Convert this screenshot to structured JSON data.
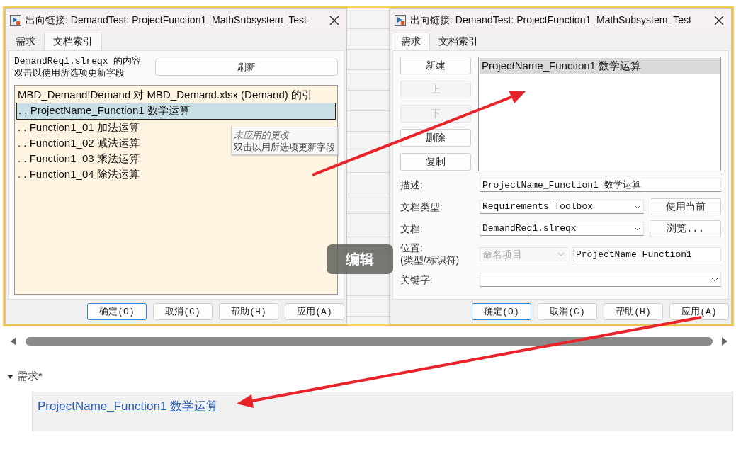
{
  "left_dialog": {
    "title": "出向链接: DemandTest: ProjectFunction1_MathSubsystem_Test",
    "tabs": [
      {
        "label": "需求",
        "selected": false
      },
      {
        "label": "文档索引",
        "selected": true
      }
    ],
    "info_lines": [
      "DemandReq1.slreqx 的内容",
      "双击以使用所选项更新字段"
    ],
    "refresh_button": "刷新",
    "list_header": "MBD_Demand!Demand 对 MBD_Demand.xlsx (Demand) 的引",
    "items": [
      {
        "text": ". . ProjectName_Function1 数学运算",
        "selected": true
      },
      {
        "text": ". . Function1_01 加法运算",
        "selected": false
      },
      {
        "text": ". . Function1_02 减法运算",
        "selected": false
      },
      {
        "text": ". . Function1_03 乘法运算",
        "selected": false
      },
      {
        "text": ". . Function1_04 除法运算",
        "selected": false
      }
    ],
    "tooltip": {
      "title": "未应用的更改",
      "text": "双击以用所选项更新字段"
    },
    "buttons": [
      {
        "label": "确定(O)",
        "default": true
      },
      {
        "label": "取消(C)",
        "default": false
      },
      {
        "label": "帮助(H)",
        "default": false
      },
      {
        "label": "应用(A)",
        "default": false
      }
    ]
  },
  "right_dialog": {
    "title": "出向链接: DemandTest: ProjectFunction1_MathSubsystem_Test",
    "tabs": [
      {
        "label": "需求",
        "selected": true
      },
      {
        "label": "文档索引",
        "selected": false
      }
    ],
    "side_buttons": [
      {
        "label": "新建",
        "disabled": false
      },
      {
        "label": "上",
        "disabled": true
      },
      {
        "label": "下",
        "disabled": true
      },
      {
        "label": "删除",
        "disabled": false
      },
      {
        "label": "复制",
        "disabled": false
      }
    ],
    "requirements": [
      {
        "text": "ProjectName_Function1 数学运算",
        "selected": true
      }
    ],
    "fields": [
      {
        "kind": "text",
        "label": "描述:",
        "value": "ProjectName_Function1 数学运算"
      },
      {
        "kind": "select_button",
        "label": "文档类型:",
        "value": "Requirements Toolbox",
        "button": "使用当前"
      },
      {
        "kind": "select_button",
        "label": "文档:",
        "value": "DemandReq1.slreqx",
        "button": "浏览..."
      },
      {
        "kind": "select_text",
        "label": "位置:",
        "sublabel": "(类型/标识符)",
        "select": "命名项目",
        "select_disabled": true,
        "value": "ProjectName_Function1"
      },
      {
        "kind": "select",
        "label": "关键字:"
      }
    ],
    "buttons": [
      {
        "label": "确定(O)",
        "default": true
      },
      {
        "label": "取消(C)",
        "default": false
      },
      {
        "label": "帮助(H)",
        "default": false
      },
      {
        "label": "应用(A)",
        "default": false
      }
    ]
  },
  "toast": "编辑",
  "section": {
    "title": "需求*",
    "expanded": true,
    "link": "ProjectName_Function1 数学运算"
  }
}
